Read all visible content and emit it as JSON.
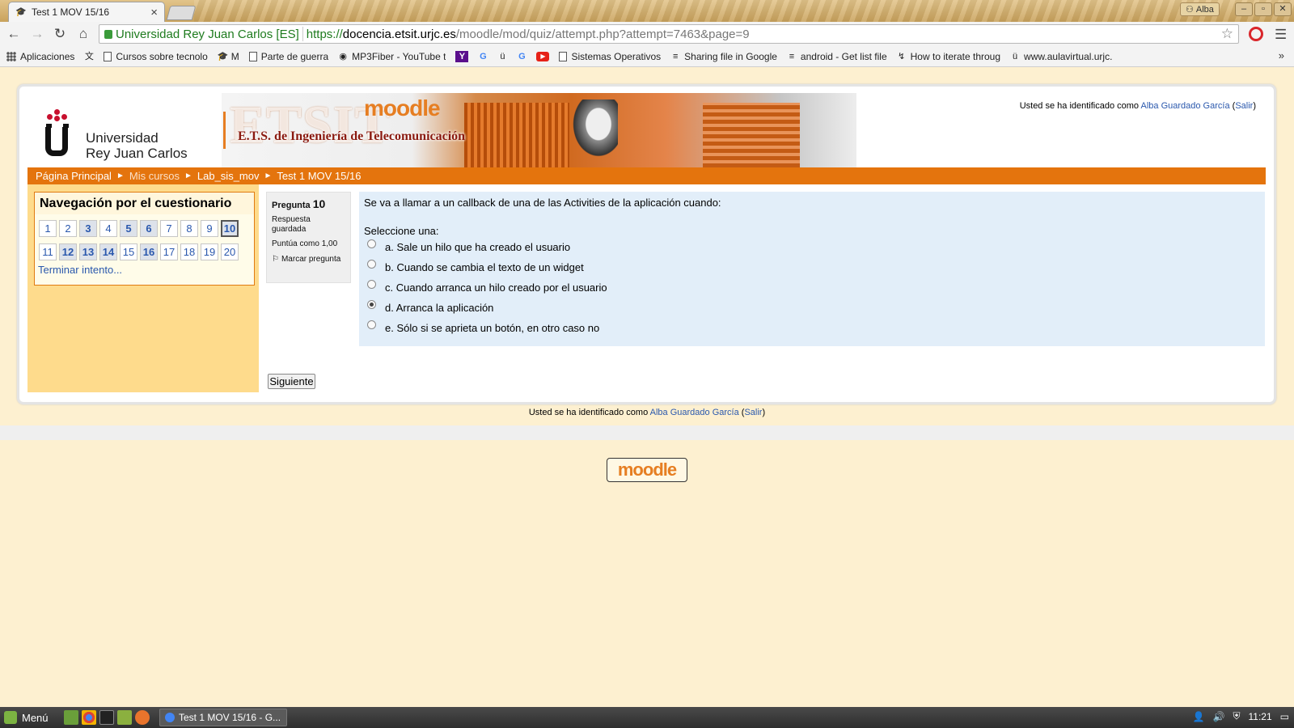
{
  "browser": {
    "tab_title": "Test 1 MOV 15/16",
    "tab_favicon": "moodle-hat-icon",
    "profile_name": "Alba",
    "window_buttons": [
      "–",
      "▫",
      "✕"
    ],
    "address": {
      "ev_name": "Universidad Rey Juan Carlos [ES]",
      "scheme": "https://",
      "host": "docencia.etsit.urjc.es",
      "path": "/moodle/mod/quiz/attempt.php?attempt=7463&page=9"
    },
    "bookmarks": [
      {
        "icon": "apps-grid-icon",
        "label": "Aplicaciones"
      },
      {
        "icon": "google-translate-icon",
        "label": ""
      },
      {
        "icon": "document-icon",
        "label": "Cursos sobre tecnolo"
      },
      {
        "icon": "moodle-hat-icon",
        "label": "M"
      },
      {
        "icon": "document-icon",
        "label": "Parte de guerra"
      },
      {
        "icon": "mp3fiber-icon",
        "label": "MP3Fiber - YouTube t"
      },
      {
        "icon": "yahoo-icon",
        "label": ""
      },
      {
        "icon": "google-icon",
        "label": ""
      },
      {
        "icon": "urjc-icon",
        "label": ""
      },
      {
        "icon": "google-icon",
        "label": ""
      },
      {
        "icon": "youtube-icon",
        "label": ""
      },
      {
        "icon": "document-icon",
        "label": "Sistemas Operativos"
      },
      {
        "icon": "stackoverflow-icon",
        "label": "Sharing file in Google"
      },
      {
        "icon": "stackoverflow-icon",
        "label": "android - Get list file"
      },
      {
        "icon": "generic-site-icon",
        "label": "How to iterate throug"
      },
      {
        "icon": "urjc-icon",
        "label": "www.aulavirtual.urjc."
      }
    ],
    "bookmarks_overflow": "»"
  },
  "header": {
    "university_line1": "Universidad",
    "university_line2": "Rey Juan Carlos",
    "banner_big": "ETSIT",
    "banner_moodle": "moodle",
    "banner_subtitle": "E.T.S. de Ingeniería de Telecomunicación",
    "login_prefix": "Usted se ha identificado como ",
    "user_name": "Alba Guardado García",
    "logout_label": "Salir"
  },
  "breadcrumb": [
    "Página Principal",
    "Mis cursos",
    "Lab_sis_mov",
    "Test 1 MOV 15/16"
  ],
  "quiz_nav": {
    "title": "Navegación por el cuestionario",
    "questions": [
      {
        "n": "1",
        "answered": false
      },
      {
        "n": "2",
        "answered": false
      },
      {
        "n": "3",
        "answered": true
      },
      {
        "n": "4",
        "answered": false
      },
      {
        "n": "5",
        "answered": true
      },
      {
        "n": "6",
        "answered": true
      },
      {
        "n": "7",
        "answered": false
      },
      {
        "n": "8",
        "answered": false
      },
      {
        "n": "9",
        "answered": false
      },
      {
        "n": "10",
        "answered": true,
        "current": true
      },
      {
        "n": "11",
        "answered": false
      },
      {
        "n": "12",
        "answered": true
      },
      {
        "n": "13",
        "answered": true
      },
      {
        "n": "14",
        "answered": true
      },
      {
        "n": "15",
        "answered": false
      },
      {
        "n": "16",
        "answered": true
      },
      {
        "n": "17",
        "answered": false
      },
      {
        "n": "18",
        "answered": false
      },
      {
        "n": "19",
        "answered": false
      },
      {
        "n": "20",
        "answered": false
      }
    ],
    "finish_label": "Terminar intento..."
  },
  "question": {
    "label": "Pregunta",
    "number": "10",
    "state": "Respuesta guardada",
    "grade": "Puntúa como 1,00",
    "flag_label": "Marcar pregunta",
    "text": "Se va a llamar a un callback de una de las Activities de la aplicación cuando:",
    "prompt": "Seleccione una:",
    "options": [
      {
        "label": "a. Sale un hilo que ha creado el usuario",
        "selected": false
      },
      {
        "label": "b. Cuando se cambia el texto de un widget",
        "selected": false
      },
      {
        "label": "c. Cuando arranca un hilo creado por el usuario",
        "selected": false
      },
      {
        "label": "d. Arranca la aplicación",
        "selected": true
      },
      {
        "label": "e. Sólo si se aprieta un botón, en otro caso no",
        "selected": false
      }
    ],
    "next_label": "Siguiente"
  },
  "footer": {
    "moodle_logo": "moodle"
  },
  "taskbar": {
    "menu_label": "Menú",
    "task_label": "Test 1 MOV 15/16 - G...",
    "clock": "11:21"
  },
  "colors": {
    "accent_orange": "#e4740d",
    "link_blue": "#2a58ad",
    "page_bg": "#fdf0d0",
    "left_col_bg": "#fedb8c",
    "question_bg": "#e2eef9"
  }
}
